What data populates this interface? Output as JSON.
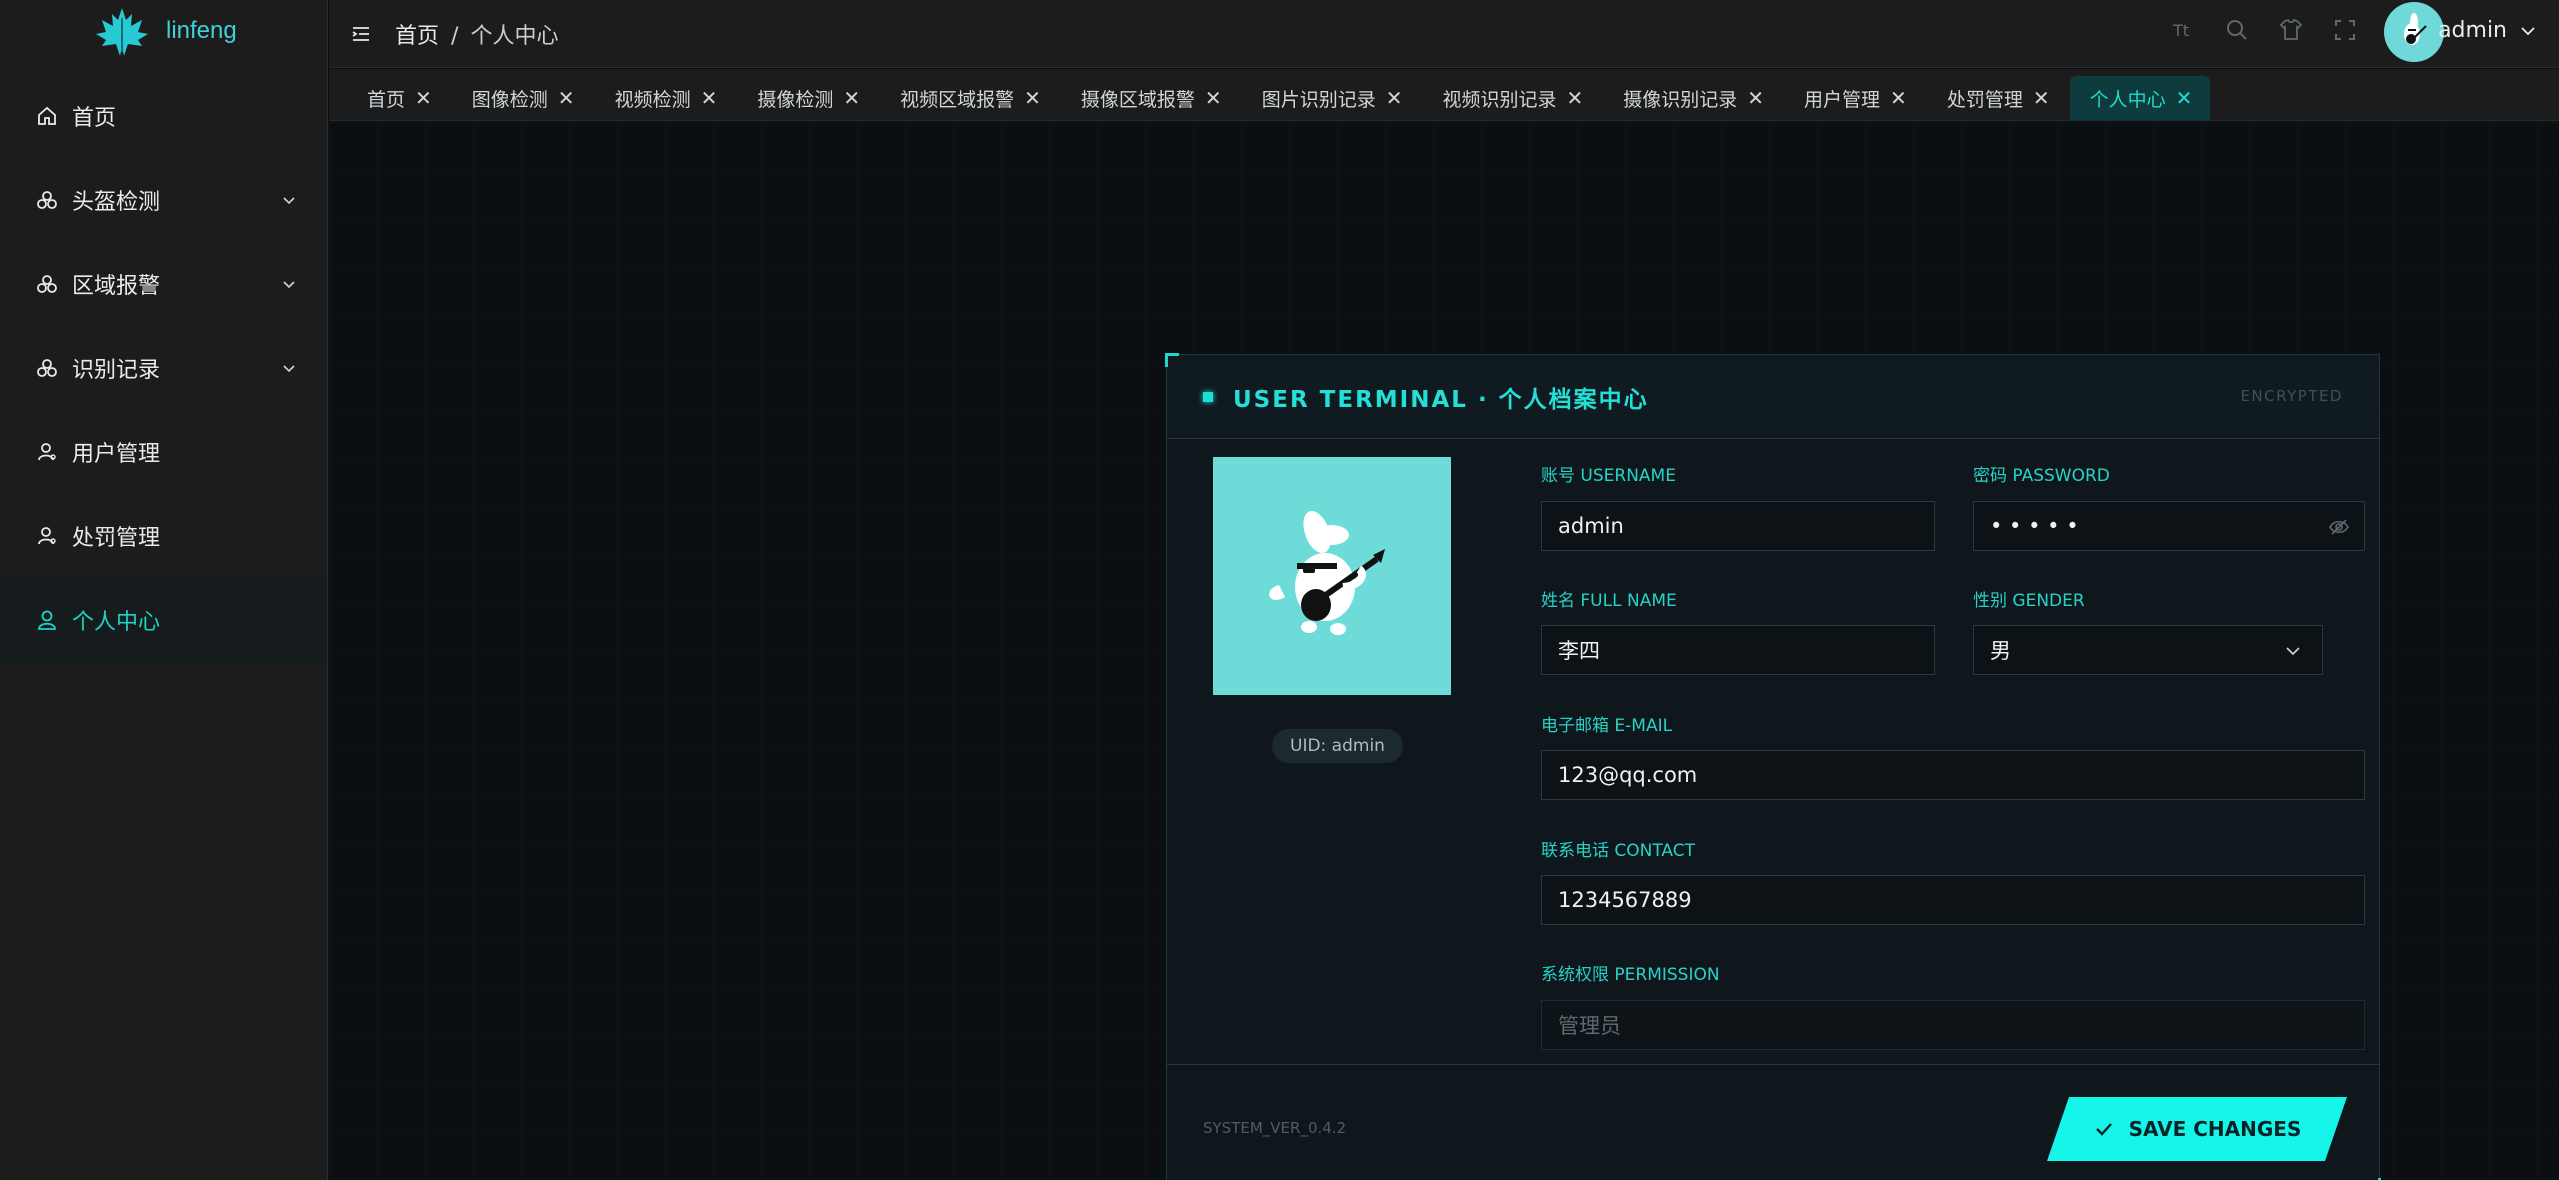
{
  "sidebar": {
    "app_name": "linfeng",
    "items": [
      {
        "label": "首页",
        "icon": "home-icon"
      },
      {
        "label": "头盔检测",
        "icon": "cluster-icon"
      },
      {
        "label": "区域报警",
        "icon": "cluster-icon"
      },
      {
        "label": "识别记录",
        "icon": "cluster-icon"
      },
      {
        "label": "用户管理",
        "icon": "user-icon"
      },
      {
        "label": "处罚管理",
        "icon": "user-icon"
      },
      {
        "label": "个人中心",
        "icon": "person-icon"
      }
    ]
  },
  "header": {
    "breadcrumb": [
      "首页",
      "个人中心"
    ],
    "breadcrumb_sep": "/",
    "user": "admin"
  },
  "tabs": [
    "首页",
    "图像检测",
    "视频检测",
    "摄像检测",
    "视频区域报警",
    "摄像区域报警",
    "图片识别记录",
    "视频识别记录",
    "摄像识别记录",
    "用户管理",
    "处罚管理",
    "个人中心"
  ],
  "tab_close": "✕",
  "profile": {
    "title": "USER TERMINAL · 个人档案中心",
    "tag": "ENCRYPTED",
    "uid": "UID: admin",
    "username_label": "账号 USERNAME",
    "username": "admin",
    "password_label": "密码 PASSWORD",
    "password_mask": "• • • • •",
    "fullname_label": "姓名 FULL NAME",
    "fullname": "李四",
    "gender_label": "性别 GENDER",
    "gender": "男",
    "email_label": "电子邮箱 E-MAIL",
    "email": "123@qq.com",
    "contact_label": "联系电话 CONTACT",
    "contact": "1234567889",
    "permission_label": "系统权限 PERMISSION",
    "permission": "管理员",
    "version": "SYSTEM_VER_0.4.2",
    "save_label": "SAVE CHANGES"
  },
  "colors": {
    "accent": "#15f5ea",
    "sidebar_bg": "#1c1c1c",
    "main_bg": "#0b0f12"
  }
}
